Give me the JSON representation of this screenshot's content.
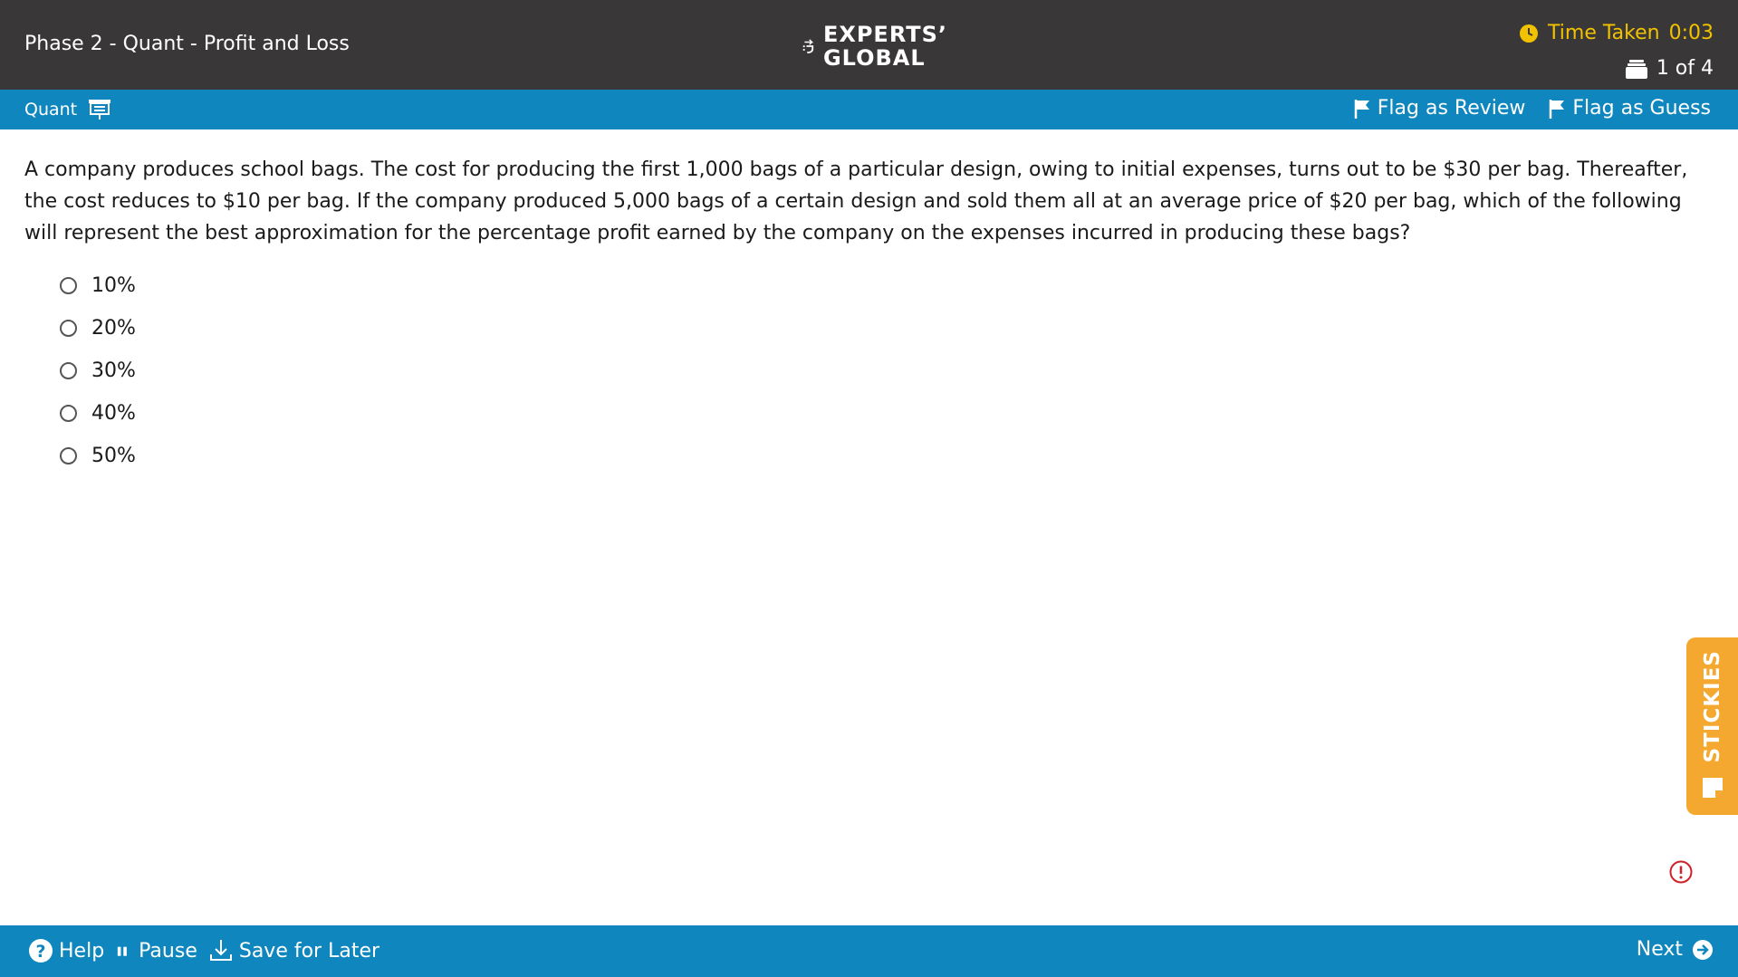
{
  "header": {
    "section_title": "Phase 2 - Quant - Profit and Loss",
    "logo": {
      "line1": "EXPERTS’",
      "line2": "GLOBAL"
    },
    "timer_label": "Time Taken",
    "timer_value": "0:03",
    "progress": "1 of 4"
  },
  "subbar": {
    "section": "Quant",
    "flag_review": "Flag as Review",
    "flag_guess": "Flag as Guess"
  },
  "question": {
    "text": "A company produces school bags. The cost for producing the first 1,000 bags of a particular design, owing to initial expenses, turns out to be $30 per bag. Thereafter, the cost reduces to $10 per bag. If the company produced 5,000 bags of a certain design and sold them all at an average price of $20 per bag, which of the following will represent the best approximation for the percentage profit earned by the company on the expenses incurred in producing these bags?",
    "options": [
      "10%",
      "20%",
      "30%",
      "40%",
      "50%"
    ]
  },
  "stickies_label": "STICKIES",
  "footer": {
    "help": "Help",
    "pause": "Pause",
    "save": "Save for Later",
    "next": "Next"
  },
  "colors": {
    "header_bg": "#3a3738",
    "bar_blue": "#0f87be",
    "timer_yellow": "#f2c200",
    "stickies_orange": "#f5a830",
    "alert_red": "#d0202a"
  }
}
